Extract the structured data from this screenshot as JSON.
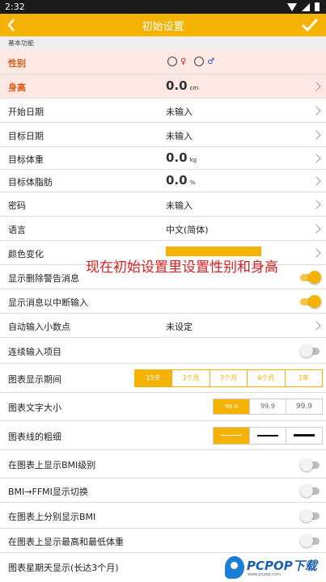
{
  "status_bar": {
    "time": "2:32"
  },
  "app_bar": {
    "title": "初始设置"
  },
  "section_header": "基本功能",
  "gender": {
    "label": "性别"
  },
  "rows": [
    {
      "label": "身高",
      "num": "0.0",
      "unit": "cm"
    },
    {
      "label": "开始日期",
      "value": "未输入"
    },
    {
      "label": "目标日期",
      "value": "未输入"
    },
    {
      "label": "目标体重",
      "num": "0.0",
      "unit": "kg"
    },
    {
      "label": "目标体脂肪",
      "num": "0.0",
      "unit": "%"
    },
    {
      "label": "密码",
      "value": "未输入"
    },
    {
      "label": "语言",
      "value": "中文(简体)"
    },
    {
      "label": "颜色变化"
    },
    {
      "label": "显示删除警告消息",
      "toggle": true
    },
    {
      "label": "显示消息以中断输入",
      "toggle": true
    },
    {
      "label": "自动输入小数点",
      "value": "未设定"
    },
    {
      "label": "连续输入项目",
      "toggle": false
    },
    {
      "label": "图表显示期间"
    },
    {
      "label": "图表文字大小"
    },
    {
      "label": "图表线的粗细"
    },
    {
      "label": "在图表上显示BMI级别",
      "toggle": false
    },
    {
      "label": "BMI→FFMI显示切换",
      "toggle": false
    },
    {
      "label": "在图表上分别显示BMI",
      "toggle": false
    },
    {
      "label": "在图表上显示最高和最低体重",
      "toggle": false
    },
    {
      "label": "图表星期天显示(长达3个月)"
    }
  ],
  "chart_period_options": [
    "15天",
    "1个月",
    "3个月",
    "6个月",
    "1年"
  ],
  "chart_period_selected": "15天",
  "chart_font_options": [
    "99.9",
    "99.9",
    "99.9"
  ],
  "chart_font_selected_index": 0,
  "chart_line_selected_index": 0,
  "overlay_caption": "现在初始设置里设置性别和身高",
  "watermark": {
    "brand": "PCPOP下载",
    "sub": "www.pcpop.com"
  },
  "colors": {
    "accent": "#f5b200",
    "highlight_row": "#fde8e4",
    "highlight_text": "#e05a1a",
    "caption_red": "#d81e1e"
  },
  "icons": {
    "back": "chevron-left-icon",
    "done": "check-icon",
    "female": "female-icon",
    "male": "male-icon"
  }
}
